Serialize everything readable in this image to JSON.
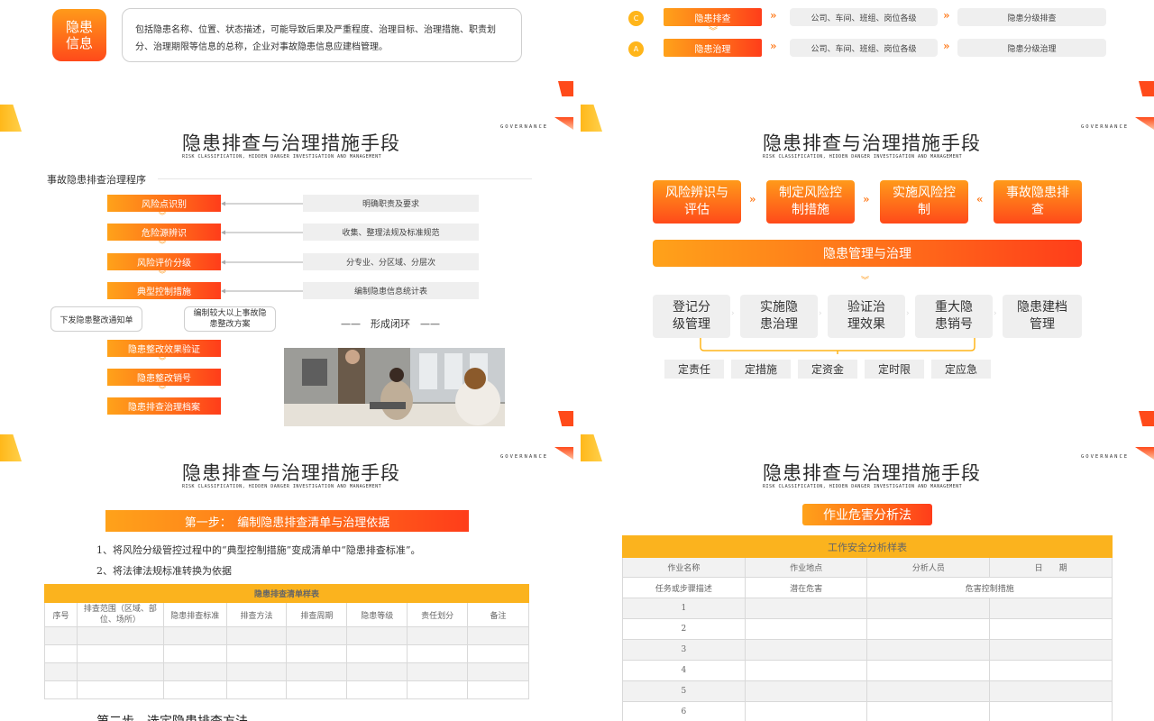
{
  "colors": {
    "accent": "#ff6a1a",
    "accent_light": "#ffa21a",
    "table_header": "#fbb31e",
    "grey": "#efefef"
  },
  "top_left": {
    "badge": "隐患信息",
    "desc": "包括隐患名称、位置、状态描述，可能导致后果及严重程度、治理目标、治理措施、职责划分、治理期限等信息的总称，企业对事故隐患信息应建档管理。"
  },
  "top_right": {
    "rows": [
      {
        "letter": "C",
        "step": "隐患排查",
        "units": "公司、车间、班组、岗位各级",
        "result": "隐患分级排查"
      },
      {
        "letter": "A",
        "step": "隐患治理",
        "units": "公司、车间、班组、岗位各级",
        "result": "隐患分级治理"
      }
    ]
  },
  "common": {
    "title": "隐患排查与治理措施手段",
    "subtitle": "RISK CLASSIFICATION, HIDDEN DANGER INVESTIGATION AND MANAGEMENT",
    "brand": "GOVERNANCE"
  },
  "panel_tl": {
    "section": "事故隐患排查治理程序",
    "steps": [
      "风险点识别",
      "危险源辨识",
      "风险评价分级",
      "典型控制措施",
      "隐患整改效果验证",
      "隐患整改销号",
      "隐患排查治理档案"
    ],
    "side_notes": [
      "明确职责及要求",
      "收集、整理法规及标准规范",
      "分专业、分区域、分层次",
      "编制隐患信息统计表"
    ],
    "left_box": "下发隐患整改通知单",
    "mid_box": "编制较大以上事故隐患整改方案",
    "loop": "——　形成闭环　——"
  },
  "panel_tr": {
    "top_boxes": [
      "风险辨识与评估",
      "制定风险控制措施",
      "实施风险控制",
      "事故隐患排查"
    ],
    "banner": "隐患管理与治理",
    "grey_boxes": [
      "登记分级管理",
      "实施隐患治理",
      "验证治理效果",
      "重大隐患销号",
      "隐患建档管理"
    ],
    "fives": [
      "定责任",
      "定措施",
      "定资金",
      "定时限",
      "定应急"
    ]
  },
  "panel_bl": {
    "step1": "第一步：　编制隐患排查清单与治理依据",
    "line1": "1、将风险分级管控过程中的“典型控制措施”变成清单中“隐患排查标准”。",
    "line2": "2、将法律法规标准转换为依据",
    "table_title": "隐患排查清单样表",
    "columns": [
      "序号",
      "排查范围（区域、部位、场所）",
      "隐患排查标准",
      "排查方法",
      "排查周期",
      "隐患等级",
      "责任划分",
      "备注"
    ],
    "step2": "第二步　选定隐患排查方法"
  },
  "panel_br": {
    "method": "作业危害分析法",
    "table_title": "工作安全分析样表",
    "row1": [
      "作业名称",
      "作业地点",
      "分析人员",
      "日　　期"
    ],
    "row2": [
      "任务或步骤描述",
      "潜在危害",
      "危害控制措施"
    ],
    "numbers": [
      "1",
      "2",
      "3",
      "4",
      "5",
      "6"
    ]
  }
}
